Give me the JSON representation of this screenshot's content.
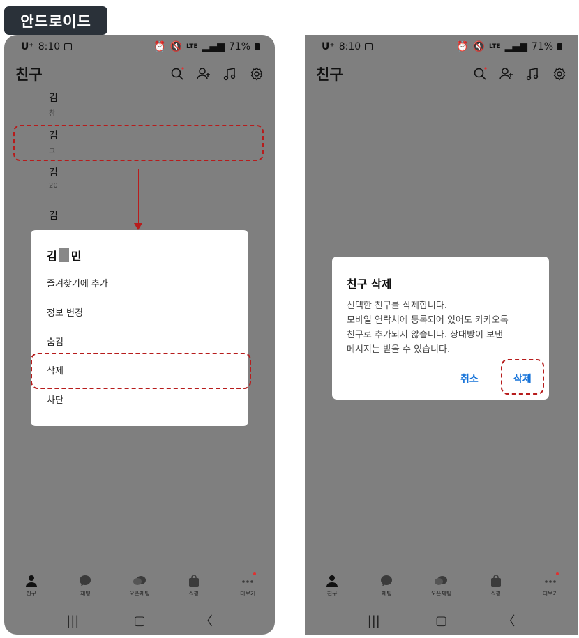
{
  "platform_tag": "안드로이드",
  "status_bar": {
    "carrier": "U⁺",
    "time": "8:10",
    "network": "LTE",
    "battery": "71%"
  },
  "app_bar": {
    "title": "친구"
  },
  "friend_list": {
    "names": [
      "김",
      "김",
      "김",
      "김"
    ],
    "statuses": [
      "참",
      "그",
      "20",
      ""
    ]
  },
  "context_menu": {
    "name_first": "김",
    "name_last": "민",
    "items": [
      "즐겨찾기에 추가",
      "정보 변경",
      "숨김",
      "삭제",
      "차단"
    ]
  },
  "delete_dialog": {
    "title": "친구 삭제",
    "lines": [
      "선택한 친구를 삭제합니다.",
      "모바일 연락처에 등록되어 있어도 카카오톡",
      "친구로 추가되지 않습니다. 상대방이 보낸",
      "메시지는 받을 수 있습니다."
    ],
    "cancel_label": "취소",
    "delete_label": "삭제"
  },
  "bottom_nav": [
    "친구",
    "채팅",
    "오픈채팅",
    "쇼핑",
    "더보기"
  ],
  "colors": {
    "overlay": "#7f7f7f",
    "accent": "#1673d9",
    "annotation": "#b71c1c",
    "tag_bg": "#2a3139"
  }
}
